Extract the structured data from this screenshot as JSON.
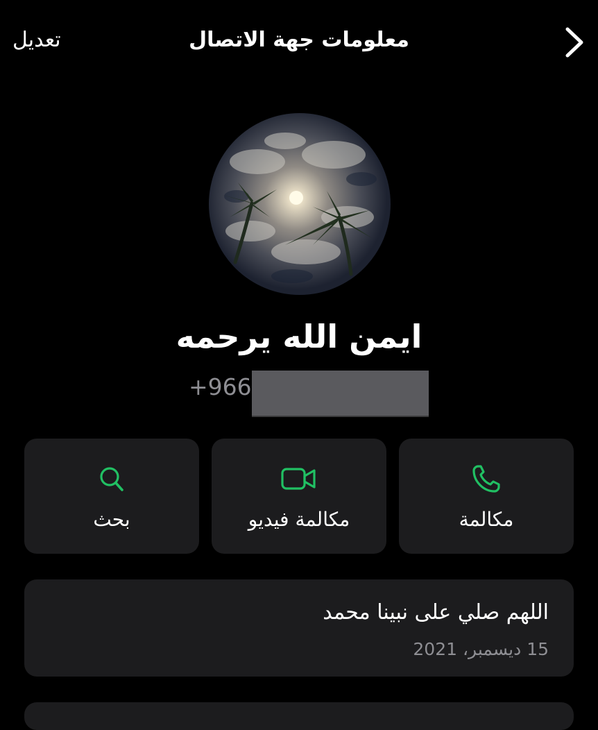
{
  "nav": {
    "edit_label": "تعديل",
    "title": "معلومات جهة الاتصال",
    "back_icon": "chevron-right-icon"
  },
  "contact": {
    "name": "ايمن الله يرحمه",
    "phone_prefix": "+966"
  },
  "actions": [
    {
      "label": "مكالمة",
      "icon": "phone-icon"
    },
    {
      "label": "مكالمة فيديو",
      "icon": "video-icon"
    },
    {
      "label": "بحث",
      "icon": "search-icon"
    }
  ],
  "about": {
    "text": "اللهم صلي على نبينا محمد",
    "date": "15 ديسمبر، 2021"
  },
  "colors": {
    "background": "#000000",
    "card": "#1c1c1e",
    "accent": "#21c063",
    "secondary_text": "#8e8e93"
  }
}
